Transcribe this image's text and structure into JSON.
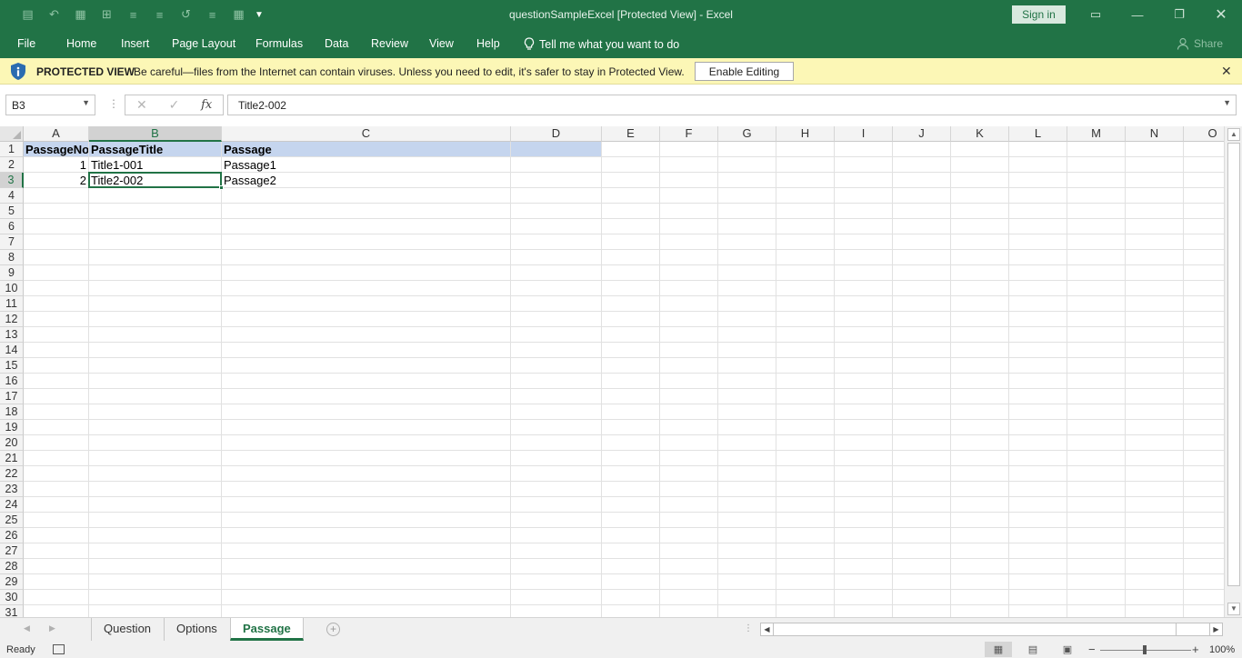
{
  "window": {
    "title": "questionSampleExcel  [Protected View]  -  Excel",
    "signin_label": "Sign in",
    "accent_color": "#217346"
  },
  "qat": {
    "icons": [
      "save-icon",
      "undo-icon",
      "redo-icon",
      "form-icon",
      "table-icon",
      "align-center-icon",
      "align-justify-icon",
      "wrap-icon",
      "indent-icon",
      "borders-icon"
    ]
  },
  "menu": {
    "items": [
      "File",
      "Home",
      "Insert",
      "Page Layout",
      "Formulas",
      "Data",
      "Review",
      "View",
      "Help"
    ],
    "tell_me": "Tell me what you want to do",
    "share": "Share"
  },
  "protected_bar": {
    "label": "PROTECTED VIEW",
    "message": "Be careful—files from the Internet can contain viruses. Unless you need to edit, it's safer to stay in Protected View.",
    "enable_button": "Enable Editing",
    "bg_color": "#fcf7b6"
  },
  "formula_bar": {
    "name_box": "B3",
    "fx_label": "fx",
    "formula": "Title2-002"
  },
  "sheet": {
    "columns": [
      "A",
      "B",
      "C",
      "D",
      "E",
      "F",
      "G",
      "H",
      "I",
      "J",
      "K",
      "L",
      "M",
      "N",
      "O"
    ],
    "row_numbers": [
      "1",
      "2",
      "3",
      "4",
      "5",
      "6",
      "7",
      "8",
      "9",
      "10",
      "11",
      "12",
      "13",
      "14",
      "15",
      "16",
      "17",
      "18",
      "19",
      "20",
      "21",
      "22",
      "23",
      "24",
      "25",
      "26",
      "27",
      "28",
      "29",
      "30",
      "31"
    ],
    "header_row": [
      "PassageNo",
      "PassageTitle",
      "Passage"
    ],
    "rows": [
      [
        "1",
        "Title1-001",
        "Passage1"
      ],
      [
        "2",
        "Title2-002",
        "Passage2"
      ]
    ],
    "selected_cell": "B3",
    "header_fill_color": "#c5d5ee"
  },
  "tabs": {
    "items": [
      "Question",
      "Options",
      "Passage"
    ],
    "active": "Passage"
  },
  "status": {
    "ready": "Ready",
    "zoom": "100%"
  }
}
